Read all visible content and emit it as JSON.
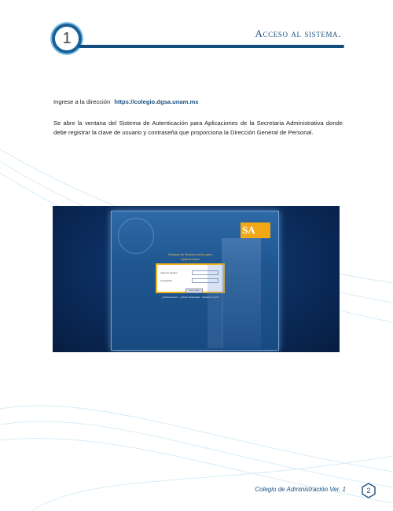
{
  "header": {
    "step_number": "1",
    "title": "Acceso al sistema."
  },
  "body": {
    "intro_text": "Ingrese a la dirección",
    "url": "https://colegio.dgsa.unam.mx",
    "description": "Se abre la ventana del Sistema de Autenticación para Aplicaciones de la Secretaria Administrativa donde debe registrar la clave de usuario y contraseña que proporciona la Dirección General de Personal."
  },
  "screenshot": {
    "logo_text": "SA",
    "title": "Sistema de Autenticación para Aplicaciones",
    "user_label": "Clave de Usuario:",
    "password_label": "Contraseña:",
    "submit_label": "Iniciar sesión",
    "links": "¿Olvidó acceso? · ¿Olvidó contraseña? · Actualiza tu perfil"
  },
  "footer": {
    "doc_title": "Colegio de Administración Ver. 1",
    "page_number": "2"
  },
  "colors": {
    "accent": "#1a4f80",
    "light_accent": "#7fc0e8",
    "gold": "#f0a817"
  }
}
